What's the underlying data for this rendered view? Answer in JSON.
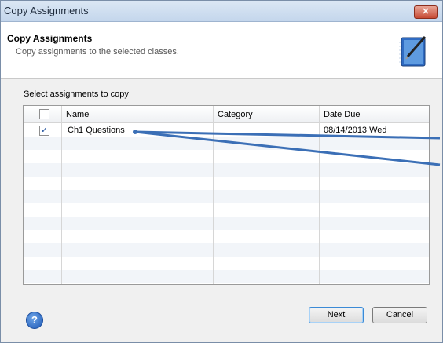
{
  "window": {
    "title": "Copy Assignments",
    "close_label": "✕"
  },
  "header": {
    "title": "Copy Assignments",
    "subtitle": "Copy assignments to the selected classes.",
    "icon": "notebook-pen-icon"
  },
  "content": {
    "select_label": "Select assignments to copy",
    "columns": [
      "Name",
      "Category",
      "Date Due"
    ],
    "rows": [
      {
        "checked": true,
        "name": "Ch1 Questions",
        "category": "",
        "date_due": "08/14/2013 Wed"
      }
    ]
  },
  "footer": {
    "help_icon": "?",
    "next_label": "Next",
    "cancel_label": "Cancel"
  }
}
